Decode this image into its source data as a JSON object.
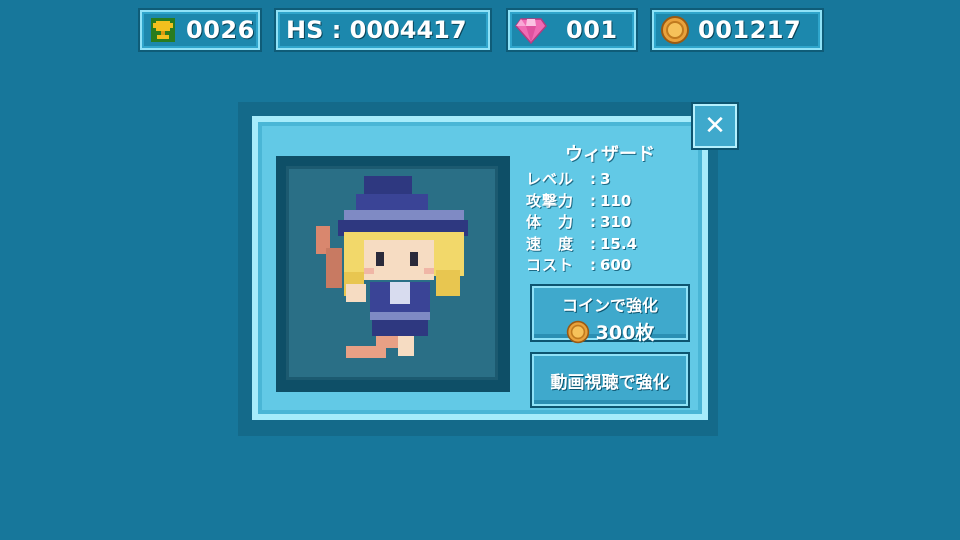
{
  "hud": {
    "trophy_count": "0026",
    "high_score": "HS : 0004417",
    "gem_count": "001",
    "coin_count": "001217"
  },
  "dialog": {
    "character_name": "ウィザード",
    "stats": [
      {
        "label": "レベル",
        "sep": ":",
        "value": "3"
      },
      {
        "label": "攻撃力",
        "sep": ":",
        "value": "110"
      },
      {
        "label": "体　力",
        "sep": ":",
        "value": "310"
      },
      {
        "label": "速　度",
        "sep": ":",
        "value": "15.4"
      },
      {
        "label": "コスト",
        "sep": ":",
        "value": "600"
      }
    ],
    "upgrade_coin_label": "コインで強化",
    "upgrade_coin_cost": "300枚",
    "upgrade_video_label": "動画視聴で強化",
    "close_symbol": "✕"
  },
  "icons": {
    "trophy": "trophy-icon",
    "gem": "gem-icon",
    "coin": "coin-icon",
    "close": "close-icon"
  },
  "colors": {
    "background": "#17779b",
    "panel": "#62c9e6",
    "gem": "#f06bb4",
    "coin": "#e9a23c"
  }
}
